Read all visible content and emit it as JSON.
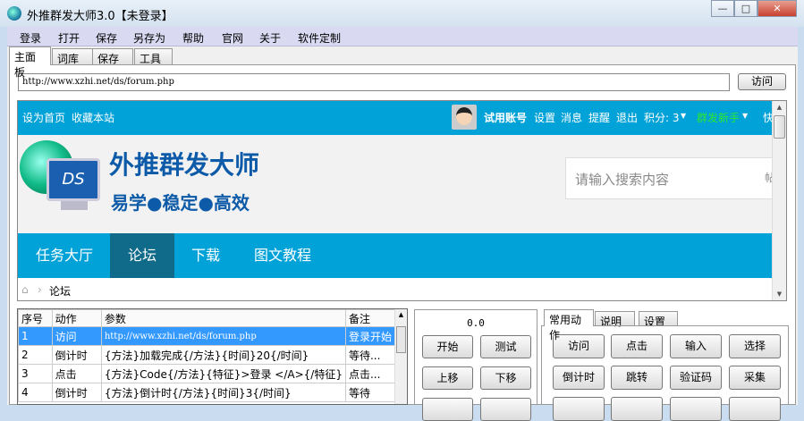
{
  "window": {
    "title": "外推群发大师3.0【未登录】",
    "minimize": "—",
    "maximize": "□",
    "close": "✕"
  },
  "menu": [
    "登录",
    "打开",
    "保存",
    "另存为",
    "帮助",
    "官网",
    "关于",
    "软件定制"
  ],
  "tabs": [
    "主面板",
    "词库",
    "保存",
    "工具"
  ],
  "url": {
    "value": "http://www.xzhi.net/ds/forum.php",
    "visit_label": "访问"
  },
  "site": {
    "top_left": [
      "设为首页",
      "收藏本站"
    ],
    "account": "试用账号",
    "links": [
      "设置",
      "消息",
      "提醒",
      "退出"
    ],
    "points": "积分: 3",
    "rank": "群发新手",
    "quick": "快",
    "logo_title": "外推群发大师",
    "logo_ds": "DS",
    "slogan": "易学●稳定●高效",
    "search_placeholder": "请输入搜索内容",
    "search_cut": "帖",
    "nav": [
      "任务大厅",
      "论坛",
      "下载",
      "图文教程"
    ],
    "breadcrumb": "论坛"
  },
  "grid": {
    "headers": [
      "序号",
      "动作",
      "参数",
      "备注"
    ],
    "rows": [
      [
        "1",
        "访问",
        "http://www.xzhi.net/ds/forum.php",
        "登录开始"
      ],
      [
        "2",
        "倒计时",
        "{方法}加载完成{/方法}{时间}20{/时间}",
        "等待..."
      ],
      [
        "3",
        "点击",
        "{方法}Code{/方法}{特征}>登录 </A>{/特征}",
        "点击..."
      ],
      [
        "4",
        "倒计时",
        "{方法}倒计时{/方法}{时间}3{/时间}",
        "等待"
      ]
    ]
  },
  "control": {
    "timer": "0.0",
    "buttons": [
      "开始",
      "测试",
      "上移",
      "下移"
    ]
  },
  "actions": {
    "tabs": [
      "常用动作",
      "说明",
      "设置"
    ],
    "buttons": [
      "访问",
      "点击",
      "输入",
      "选择",
      "倒计时",
      "跳转",
      "验证码",
      "采集"
    ]
  }
}
